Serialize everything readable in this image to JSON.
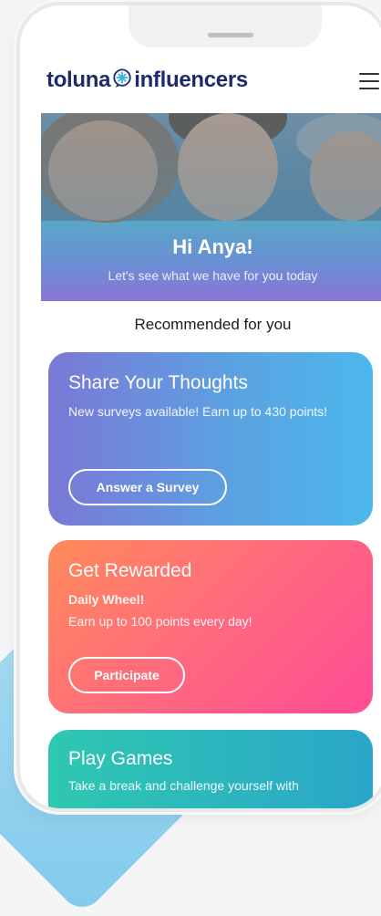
{
  "header": {
    "logo_left": "toluna",
    "logo_right": "influencers",
    "menu_icon": "hamburger-menu-icon"
  },
  "hero": {
    "greeting": "Hi Anya!",
    "subtitle": "Let's see what we have for you today"
  },
  "section": {
    "title": "Recommended for you"
  },
  "cards": [
    {
      "title": "Share Your Thoughts",
      "description": "New surveys available! Earn up to 430 points!",
      "button": "Answer a Survey"
    },
    {
      "title": "Get Rewarded",
      "subtitle": "Daily Wheel!",
      "description": "Earn up to 100 points every day!",
      "button": "Participate"
    },
    {
      "title": "Play Games",
      "description": "Take a break and challenge yourself with"
    }
  ],
  "colors": {
    "brand_navy": "#1d2b6b",
    "card1_gradient": [
      "#7a78d6",
      "#4cb7ec"
    ],
    "card2_gradient": [
      "#ff8a5a",
      "#ff4b96"
    ],
    "card3_gradient": [
      "#2ec8b0",
      "#2aa6c9"
    ]
  }
}
